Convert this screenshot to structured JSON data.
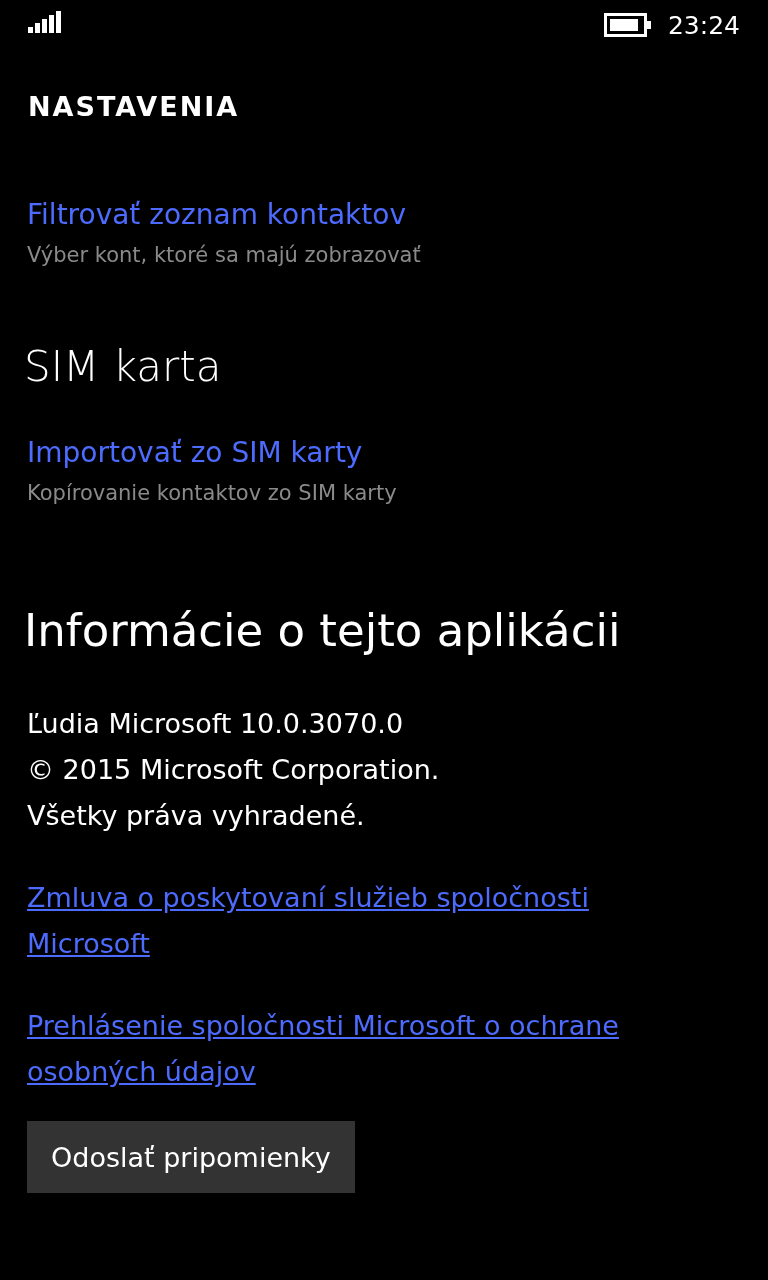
{
  "status_bar": {
    "time": "23:24"
  },
  "title": "NASTAVENIA",
  "sections": [
    {
      "items": [
        {
          "label": "Filtrovať zoznam kontaktov",
          "description": "Výber kont, ktoré sa majú zobrazovať"
        }
      ]
    },
    {
      "heading": "SIM karta",
      "items": [
        {
          "label": "Importovať zo SIM karty",
          "description": "Kopírovanie kontaktov zo SIM karty"
        }
      ]
    }
  ],
  "about": {
    "heading": "Informácie o tejto aplikácii",
    "lines": [
      "Ľudia Microsoft 10.0.3070.0",
      "© 2015 Microsoft Corporation.",
      "Všetky práva vyhradené."
    ],
    "links": [
      "Zmluva o poskytovaní služieb spoločnosti Microsoft",
      "Prehlásenie spoločnosti Microsoft o ochrane osobných údajov"
    ]
  },
  "feedback_button": "Odoslať pripomienky"
}
